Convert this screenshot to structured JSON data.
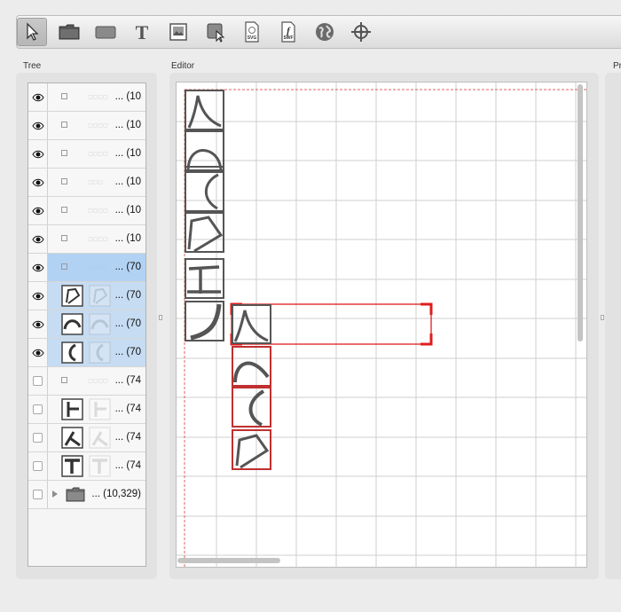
{
  "toolbar": {
    "tools": [
      {
        "name": "select-tool-icon",
        "active": true
      },
      {
        "name": "folder-tool-icon"
      },
      {
        "name": "rectangle-tool-icon"
      },
      {
        "name": "text-tool-icon"
      },
      {
        "name": "image-tool-icon"
      },
      {
        "name": "area-select-tool-icon"
      },
      {
        "name": "svg-file-tool-icon",
        "badge": "SVG"
      },
      {
        "name": "swf-file-tool-icon",
        "badge": "SWF"
      },
      {
        "name": "globe-tool-icon"
      },
      {
        "name": "crosshair-tool-icon"
      }
    ]
  },
  "panels": {
    "tree_label": "Tree",
    "editor_label": "Editor",
    "right_label": "Pr"
  },
  "tree": {
    "rows": [
      {
        "visible": true,
        "text": "... (10",
        "selected": false
      },
      {
        "visible": true,
        "text": "... (10",
        "selected": false
      },
      {
        "visible": true,
        "text": "... (10",
        "selected": false
      },
      {
        "visible": true,
        "text": "... (10",
        "selected": false
      },
      {
        "visible": true,
        "text": "... (10",
        "selected": false
      },
      {
        "visible": true,
        "text": "... (10",
        "selected": false
      },
      {
        "visible": true,
        "text": "... (70",
        "selected": true
      },
      {
        "visible": true,
        "text": "... (70",
        "selected": true
      },
      {
        "visible": true,
        "text": "... (70",
        "selected": true
      },
      {
        "visible": true,
        "text": "... (70",
        "selected": true
      },
      {
        "visible": false,
        "text": "... (74",
        "selected": false
      },
      {
        "visible": false,
        "text": "... (74",
        "selected": false
      },
      {
        "visible": false,
        "text": "... (74",
        "selected": false
      },
      {
        "visible": false,
        "text": "... (74",
        "selected": false
      },
      {
        "visible": false,
        "text": "... (10,329)",
        "selected": false,
        "folder": true
      }
    ]
  },
  "colors": {
    "selection_red": "#e01c1c",
    "tree_selection": "#b2d2f4",
    "grid_line": "#cfcfcf"
  }
}
